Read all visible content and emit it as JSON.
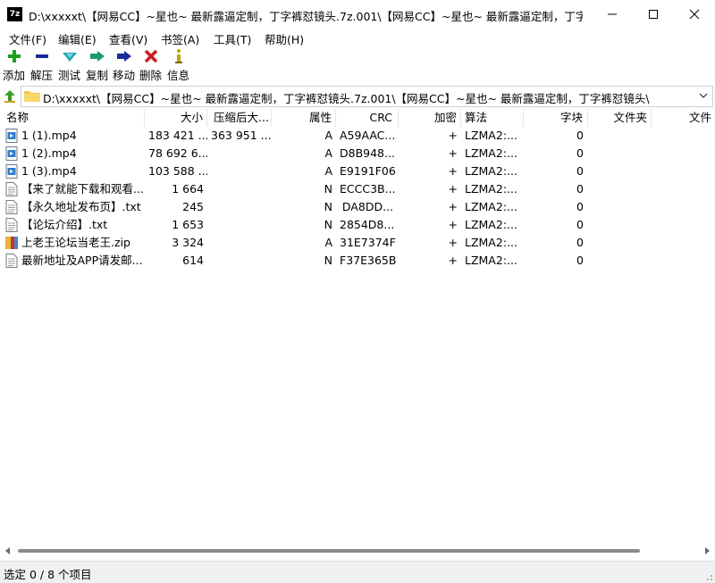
{
  "window": {
    "app_icon_text": "7z",
    "title": "D:\\xxxxxt\\【网易CC】~星也~ 最新露逼定制，丁字裤怼镜头.7z.001\\【网易CC】~星也~ 最新露逼定制，丁字..."
  },
  "menu": [
    {
      "label": "文件(F)"
    },
    {
      "label": "编辑(E)"
    },
    {
      "label": "查看(V)"
    },
    {
      "label": "书签(A)"
    },
    {
      "label": "工具(T)"
    },
    {
      "label": "帮助(H)"
    }
  ],
  "toolbar": [
    {
      "label": "添加",
      "icon": "plus-icon",
      "color": "#1aa11a"
    },
    {
      "label": "解压",
      "icon": "minus-icon",
      "color": "#1b2a9c"
    },
    {
      "label": "测试",
      "icon": "check-icon",
      "color": "#1aa8b0"
    },
    {
      "label": "复制",
      "icon": "copy-arrow-icon",
      "color": "#1a9a6e"
    },
    {
      "label": "移动",
      "icon": "move-arrow-icon",
      "color": "#1b2a9c"
    },
    {
      "label": "删除",
      "icon": "delete-x-icon",
      "color": "#d01c1c"
    },
    {
      "label": "信息",
      "icon": "info-icon",
      "color": "#c8a000"
    }
  ],
  "address": {
    "path": "D:\\xxxxxt\\【网易CC】~星也~ 最新露逼定制，丁字裤怼镜头.7z.001\\【网易CC】~星也~ 最新露逼定制，丁字裤怼镜头\\"
  },
  "columns": [
    "名称",
    "大小",
    "压缩后大...",
    "属性",
    "CRC",
    "加密",
    "算法",
    "字块",
    "文件夹",
    "文件"
  ],
  "files": [
    {
      "name": "1 (1).mp4",
      "size": "183 421 ...",
      "packed": "363 951 ...",
      "attr": "A",
      "crc": "A59AAC...",
      "enc": "+",
      "method": "LZMA2:...",
      "block": "0",
      "icon": "video-file-icon"
    },
    {
      "name": "1 (2).mp4",
      "size": "78 692 6...",
      "packed": "",
      "attr": "A",
      "crc": "D8B948...",
      "enc": "+",
      "method": "LZMA2:...",
      "block": "0",
      "icon": "video-file-icon"
    },
    {
      "name": "1 (3).mp4",
      "size": "103 588 ...",
      "packed": "",
      "attr": "A",
      "crc": "E9191F06",
      "enc": "+",
      "method": "LZMA2:...",
      "block": "0",
      "icon": "video-file-icon"
    },
    {
      "name": "【来了就能下载和观看...",
      "size": "1 664",
      "packed": "",
      "attr": "N",
      "crc": "ECCC3B...",
      "enc": "+",
      "method": "LZMA2:...",
      "block": "0",
      "icon": "text-file-icon"
    },
    {
      "name": "【永久地址发布页】.txt",
      "size": "245",
      "packed": "",
      "attr": "N",
      "crc": "DA8DD...",
      "enc": "+",
      "method": "LZMA2:...",
      "block": "0",
      "icon": "text-file-icon"
    },
    {
      "name": "【论坛介绍】.txt",
      "size": "1 653",
      "packed": "",
      "attr": "N",
      "crc": "2854D8...",
      "enc": "+",
      "method": "LZMA2:...",
      "block": "0",
      "icon": "text-file-icon"
    },
    {
      "name": "上老王论坛当老王.zip",
      "size": "3 324",
      "packed": "",
      "attr": "A",
      "crc": "31E7374F",
      "enc": "+",
      "method": "LZMA2:...",
      "block": "0",
      "icon": "zip-file-icon"
    },
    {
      "name": "最新地址及APP请发邮...",
      "size": "614",
      "packed": "",
      "attr": "N",
      "crc": "F37E365B",
      "enc": "+",
      "method": "LZMA2:...",
      "block": "0",
      "icon": "text-file-icon"
    }
  ],
  "status": {
    "selection": "选定 0 / 8 个项目"
  }
}
